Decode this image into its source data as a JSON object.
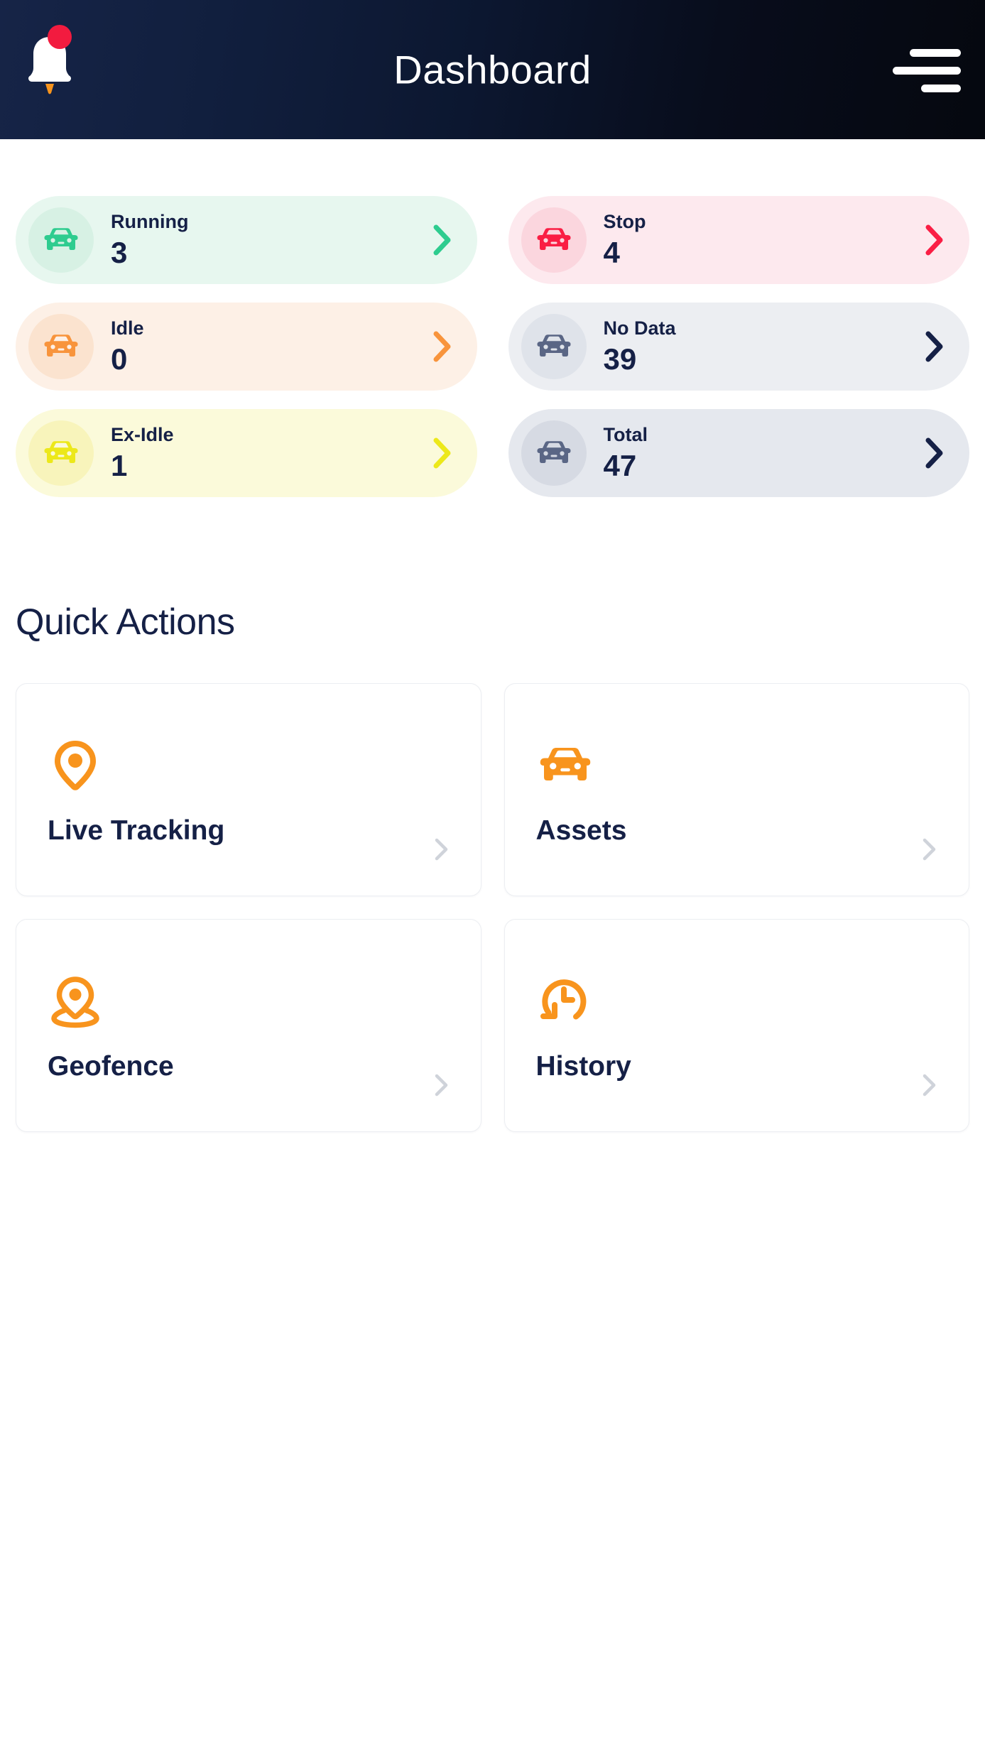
{
  "header": {
    "title": "Dashboard",
    "bell_icon": "bell-icon",
    "notification_badge": "notification-dot",
    "menu_icon": "hamburger-menu-icon",
    "bg_color": "#0b1222",
    "badge_color": "#f21b3f"
  },
  "status_cards": [
    {
      "label": "Running",
      "value": "3",
      "icon": "car-icon",
      "accent": "#2ecc8f",
      "bg": "#e7f7ef",
      "circle_bg": "#d7f1e4",
      "chevron": "chevron-right-icon"
    },
    {
      "label": "Stop",
      "value": "4",
      "icon": "car-icon",
      "accent": "#fa1e44",
      "bg": "#fde9ee",
      "circle_bg": "#fbd6de",
      "chevron": "chevron-right-icon"
    },
    {
      "label": "Idle",
      "value": "0",
      "icon": "car-icon",
      "accent": "#f8943c",
      "bg": "#fdf0e6",
      "circle_bg": "#fbe3cf",
      "chevron": "chevron-right-icon"
    },
    {
      "label": "No Data",
      "value": "39",
      "icon": "car-icon",
      "accent": "#5a6685",
      "bg": "#eceef2",
      "circle_bg": "#dfe3ea",
      "chevron": "chevron-right-icon"
    },
    {
      "label": "Ex-Idle",
      "value": "1",
      "icon": "car-icon",
      "accent": "#ece81a",
      "bg": "#fbfada",
      "circle_bg": "#f8f4bb",
      "chevron": "chevron-right-icon"
    },
    {
      "label": "Total",
      "value": "47",
      "icon": "car-icon",
      "accent": "#5a6685",
      "bg": "#e5e8ee",
      "circle_bg": "#d6dae3",
      "chevron": "chevron-right-icon"
    }
  ],
  "quick_actions": {
    "title": "Quick Actions",
    "items": [
      {
        "label": "Live Tracking",
        "icon": "map-pin-icon",
        "accent": "#f8941d",
        "chevron": "chevron-right-icon"
      },
      {
        "label": "Assets",
        "icon": "car-icon",
        "accent": "#f8941d",
        "chevron": "chevron-right-icon"
      },
      {
        "label": "Geofence",
        "icon": "geofence-pin-icon",
        "accent": "#f8941d",
        "chevron": "chevron-right-icon"
      },
      {
        "label": "History",
        "icon": "clock-history-icon",
        "accent": "#f8941d",
        "chevron": "chevron-right-icon"
      }
    ]
  }
}
